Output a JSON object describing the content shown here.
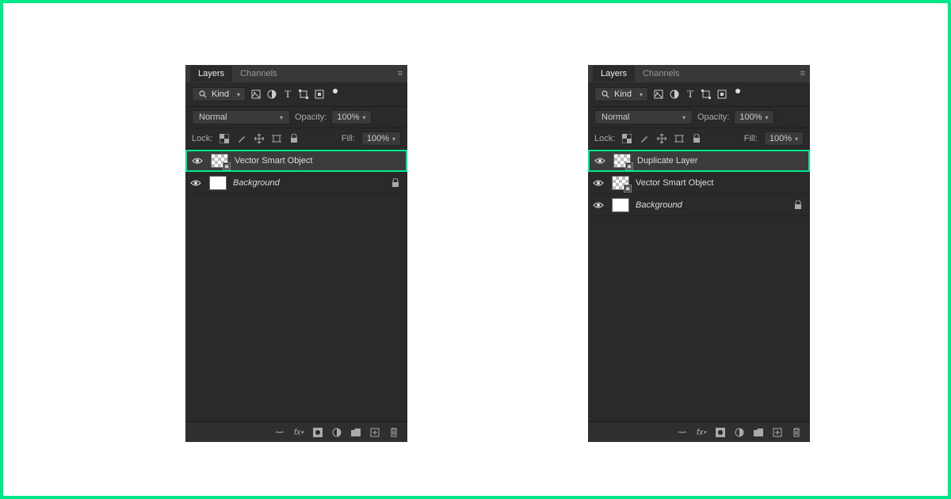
{
  "tabs": {
    "layers": "Layers",
    "channels": "Channels"
  },
  "filter": {
    "kind": "Kind"
  },
  "blend": {
    "mode": "Normal",
    "opacity_label": "Opacity:",
    "opacity_value": "100%"
  },
  "lock": {
    "label": "Lock:",
    "fill_label": "Fill:",
    "fill_value": "100%"
  },
  "left_panel": {
    "layers": [
      {
        "name": "Vector Smart Object",
        "highlighted": true,
        "checker": true,
        "smart": true
      },
      {
        "name": "Background",
        "italic": true,
        "locked": true,
        "white": true
      }
    ]
  },
  "right_panel": {
    "layers": [
      {
        "name": "Duplicate Layer",
        "highlighted": true,
        "checker": true,
        "smart": true
      },
      {
        "name": "Vector Smart Object",
        "checker": true,
        "smart": true
      },
      {
        "name": "Background",
        "italic": true,
        "locked": true,
        "white": true
      }
    ]
  }
}
